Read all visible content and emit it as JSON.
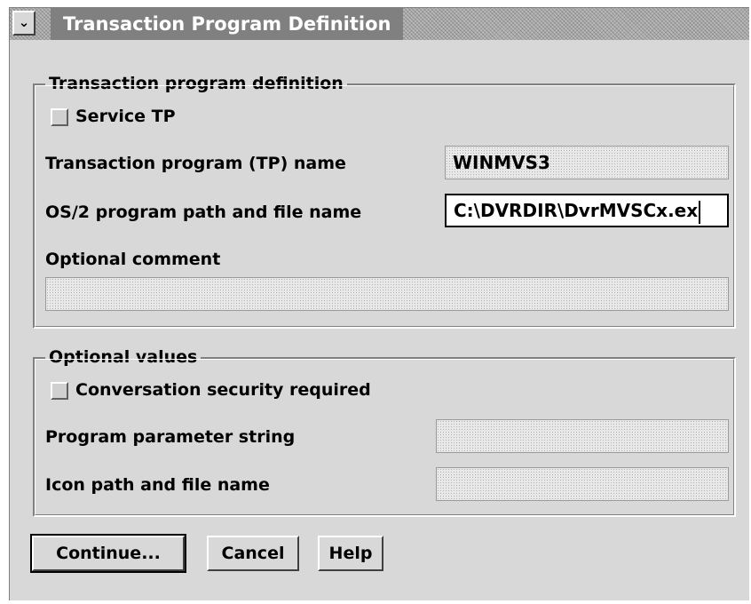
{
  "window": {
    "title": "Transaction Program Definition",
    "system_menu_glyph": "⌄"
  },
  "tp_group": {
    "label": "Transaction program definition",
    "service_tp": {
      "label": "Service TP",
      "checked": false
    },
    "tp_name": {
      "label": "Transaction program (TP) name",
      "value": "WINMVS3"
    },
    "path": {
      "label": "OS/2 program path and file name",
      "value": "C:\\DVRDIR\\DvrMVSCx.ex"
    },
    "comment": {
      "label": "Optional comment",
      "value": ""
    }
  },
  "optional_group": {
    "label": "Optional values",
    "conv_security": {
      "label": "Conversation security required",
      "checked": false
    },
    "param_string": {
      "label": "Program parameter string",
      "value": ""
    },
    "icon_path": {
      "label": "Icon path and file name",
      "value": ""
    }
  },
  "buttons": {
    "continue": "Continue...",
    "cancel": "Cancel",
    "help": "Help"
  }
}
